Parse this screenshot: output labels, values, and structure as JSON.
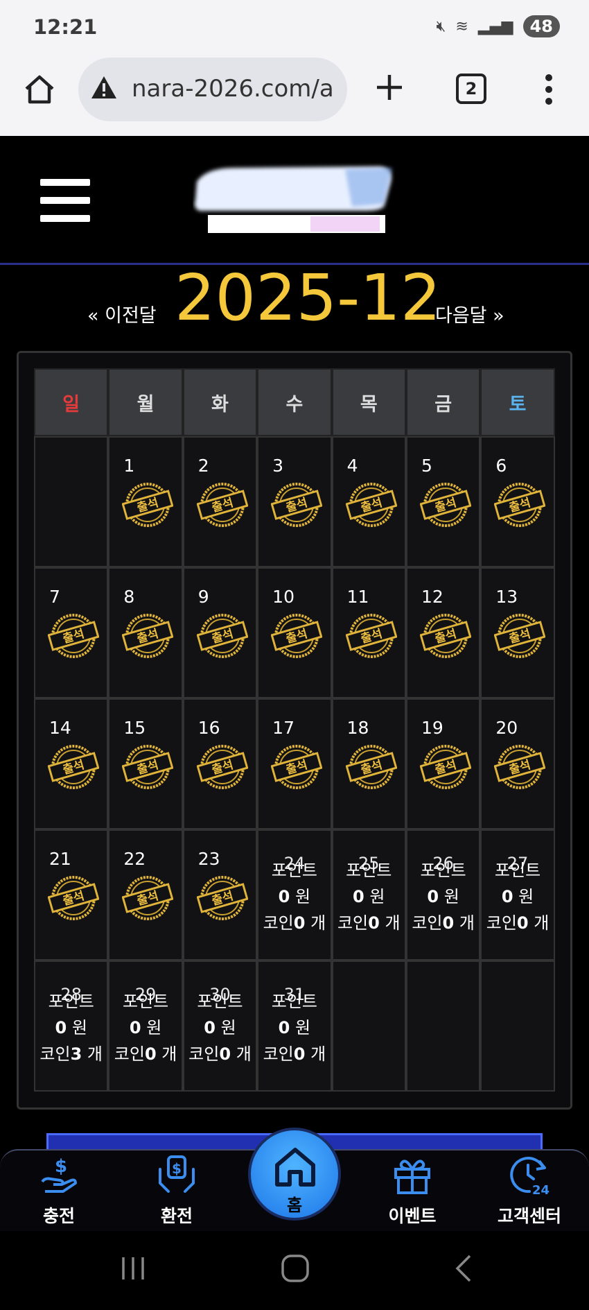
{
  "status": {
    "time": "12:21",
    "battery": "48"
  },
  "browser": {
    "url": "nara-2026.com/a",
    "tab_count": "2"
  },
  "nav": {
    "prev": "« 이전달",
    "next": "다음달 »",
    "month": "2025-12"
  },
  "weekdays": [
    "일",
    "월",
    "화",
    "수",
    "목",
    "금",
    "토"
  ],
  "stamp_label": "출석",
  "days": {
    "d1": "1",
    "d2": "2",
    "d3": "3",
    "d4": "4",
    "d5": "5",
    "d6": "6",
    "d7": "7",
    "d8": "8",
    "d9": "9",
    "d10": "10",
    "d11": "11",
    "d12": "12",
    "d13": "13",
    "d14": "14",
    "d15": "15",
    "d16": "16",
    "d17": "17",
    "d18": "18",
    "d19": "19",
    "d20": "20",
    "d21": "21",
    "d22": "22",
    "d23": "23",
    "d24": "24",
    "d25": "25",
    "d26": "26",
    "d27": "27",
    "d28": "28",
    "d29": "29",
    "d30": "30",
    "d31": "31"
  },
  "info": {
    "point_label": "포인트",
    "won_unit": "원",
    "coin_label": "코인",
    "count_unit": "개",
    "d24": {
      "point": "0",
      "coin": "0"
    },
    "d25": {
      "point": "0",
      "coin": "0"
    },
    "d26": {
      "point": "0",
      "coin": "0"
    },
    "d27": {
      "point": "0",
      "coin": "0"
    },
    "d28": {
      "point": "0",
      "coin": "3"
    },
    "d29": {
      "point": "0",
      "coin": "0"
    },
    "d30": {
      "point": "0",
      "coin": "0"
    },
    "d31": {
      "point": "0",
      "coin": "0"
    }
  },
  "bottom_nav": {
    "charge": "충전",
    "exchange": "환전",
    "home": "홈",
    "event": "이벤트",
    "support": "고객센터"
  },
  "colors": {
    "accent": "#f5c83c",
    "sunday": "#e53b3b",
    "saturday": "#5ab4ef",
    "home_button": "#1d76e8"
  }
}
